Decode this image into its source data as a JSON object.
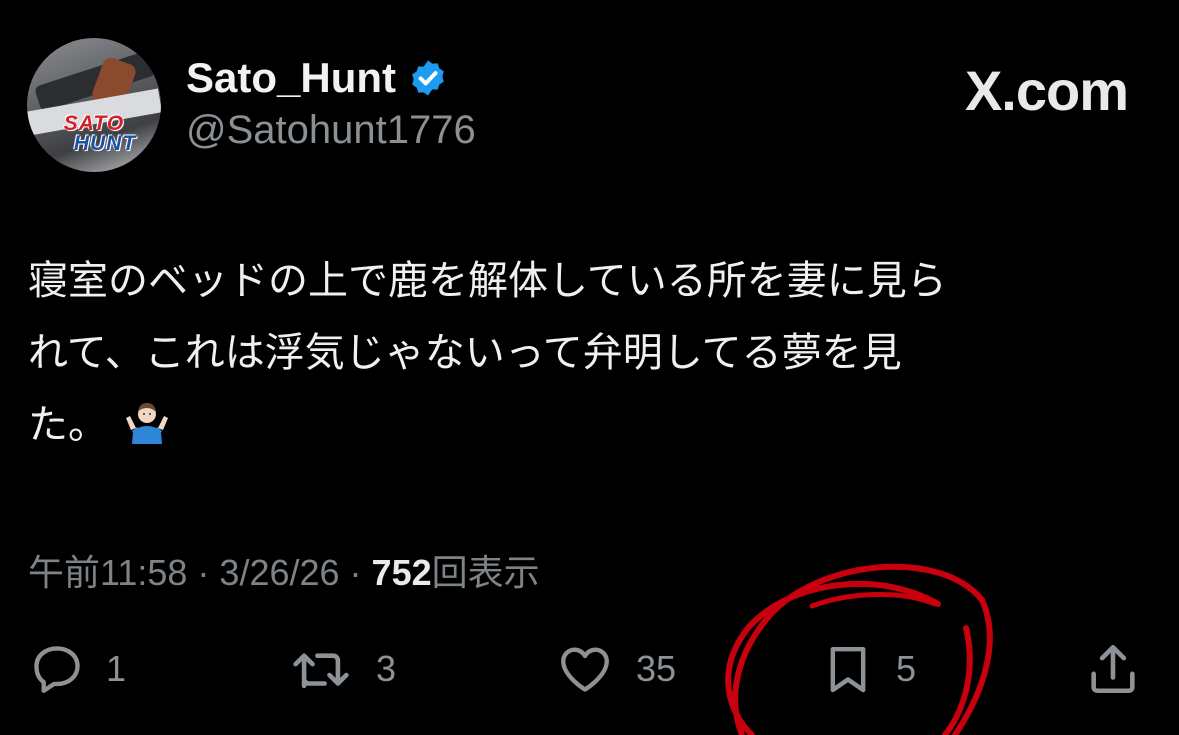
{
  "author": {
    "display_name": "Sato_Hunt",
    "handle": "@Satohunt1776",
    "verified": true,
    "avatar_logo_line1": "SATO",
    "avatar_logo_line2": "HUNT"
  },
  "brand": {
    "watermark": "X.com"
  },
  "tweet": {
    "lines": [
      "寝室のベッドの上で鹿を解体している所を妻に見ら",
      "れて、これは浮気じゃないって弁明してる夢を見",
      "た。"
    ],
    "emoji": "person-shrugging-emoji"
  },
  "meta": {
    "time": "午前11:58",
    "sep1": "·",
    "date": "3/26/26",
    "sep2": "·",
    "views": "752",
    "views_label": "回表示"
  },
  "actions": {
    "reply_count": "1",
    "repost_count": "3",
    "like_count": "35",
    "bookmark_count": "5"
  },
  "colors": {
    "background": "#000000",
    "verified_blue": "#1d9bf0",
    "annotation_red": "#c8000e",
    "muted_text": "#7e8388"
  }
}
